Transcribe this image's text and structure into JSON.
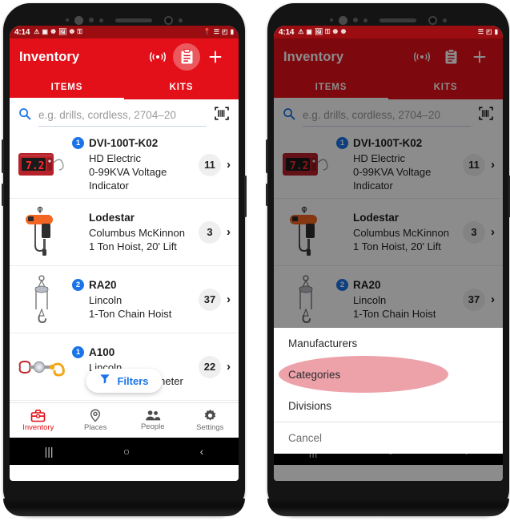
{
  "app": {
    "title": "Inventory",
    "accent_red": "#E31019",
    "statusbar_red": "#9B0D10",
    "badge_blue": "#1A73E8",
    "highlight_pink": "#EDA2AA"
  },
  "statusbar": {
    "time": "4:14",
    "left_icons": [
      "warning-icon",
      "image-error-icon",
      "screenshot-icon",
      "image-icon",
      "screenshot-icon",
      "key-icon"
    ],
    "right_icons": [
      "location-icon",
      "wifi-icon",
      "signal-icon",
      "battery-icon"
    ]
  },
  "appbar": {
    "title": "Inventory",
    "actions": [
      {
        "name": "broadcast-icon",
        "label": "((•))"
      },
      {
        "name": "clipboard-icon",
        "label": "clipboard"
      },
      {
        "name": "add-icon",
        "label": "+"
      }
    ]
  },
  "tabs": [
    {
      "label": "ITEMS",
      "active": true
    },
    {
      "label": "KITS",
      "active": false
    }
  ],
  "search": {
    "placeholder": "e.g. drills, cordless, 2704–20",
    "icon": "search-icon",
    "barcode_icon": "barcode-scan-icon"
  },
  "items": [
    {
      "badge": "1",
      "title": "DVI-100T-K02",
      "sub1": "HD Electric",
      "sub2": "0-99KVA Voltage",
      "sub3": "Indicator",
      "count": "11",
      "thumb": "voltage-indicator-thumb"
    },
    {
      "badge": "",
      "title": "Lodestar",
      "sub1": "Columbus McKinnon",
      "sub2": "1 Ton Hoist, 20' Lift",
      "sub3": "",
      "count": "3",
      "thumb": "electric-hoist-thumb"
    },
    {
      "badge": "2",
      "title": "RA20",
      "sub1": "Lincoln",
      "sub2": "1-Ton Chain Hoist",
      "sub3": "",
      "count": "37",
      "thumb": "chain-hoist-thumb"
    },
    {
      "badge": "1",
      "title": "A100",
      "sub1": "Lincoln",
      "sub2": "1-Ton Dynamometer",
      "sub3": "",
      "count": "22",
      "thumb": "dynamometer-thumb"
    }
  ],
  "filters": {
    "label": "Filters",
    "icon": "funnel-icon"
  },
  "bottom_nav": [
    {
      "label": "Inventory",
      "icon": "toolbox-icon",
      "active": true
    },
    {
      "label": "Places",
      "icon": "location-pin-icon",
      "active": false
    },
    {
      "label": "People",
      "icon": "people-icon",
      "active": false
    },
    {
      "label": "Settings",
      "icon": "gear-icon",
      "active": false
    }
  ],
  "android_nav": {
    "recents": "|||",
    "home": "○",
    "back": "‹"
  },
  "sheet": {
    "options": [
      {
        "label": "Manufacturers",
        "highlighted": false
      },
      {
        "label": "Categories",
        "highlighted": true
      },
      {
        "label": "Divisions",
        "highlighted": false
      }
    ],
    "cancel": "Cancel"
  }
}
